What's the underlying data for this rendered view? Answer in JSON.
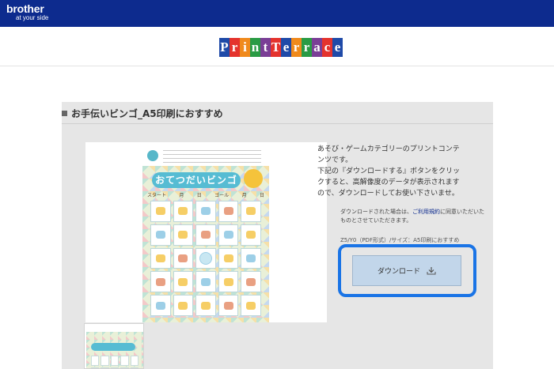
{
  "header": {
    "brand_name": "brother",
    "brand_tagline": "at your side"
  },
  "logo": {
    "letters": [
      "P",
      "r",
      "i",
      "n",
      "t",
      "T",
      "e",
      "r",
      "r",
      "a",
      "c",
      "e"
    ],
    "colors": [
      "#1f4aa8",
      "#e4332d",
      "#f08a1c",
      "#2a9b45",
      "#7a3e96",
      "#e4332d",
      "#1f4aa8",
      "#f08a1c",
      "#2a9b45",
      "#7a3e96",
      "#e4332d",
      "#1f4aa8"
    ]
  },
  "panel": {
    "title": "お手伝いビンゴ_A5印刷におすすめ"
  },
  "preview": {
    "sheet_title": "おてつだいビンゴ",
    "row_labels": [
      "スタート",
      "月",
      "日",
      "ゴール",
      "月",
      "日"
    ]
  },
  "description": {
    "line1": "あそび・ゲームカテゴリーのプリントコンテ",
    "line2": "ンツです。",
    "line3": "下記の『ダウンロードする』ボタンをクリッ",
    "line4": "クすると、高解像度のデータが表示されます",
    "line5": "ので、ダウンロードしてお使い下さいませ。"
  },
  "note": {
    "prefix": "ダウンロードされた場合は、",
    "link": "ご利用規約",
    "suffix": "に同意いただいたものとさせていただきます。"
  },
  "note2": "Z5/Y0（PDF形式）/サイズ：A5印刷におすすめ",
  "download": {
    "label": "ダウンロード",
    "icon": "download-icon"
  },
  "colors": {
    "header_bg": "#0d2b8e",
    "panel_bg": "#e6e6e6",
    "button_bg": "#c2d6ea",
    "highlight": "#1a74e6"
  }
}
